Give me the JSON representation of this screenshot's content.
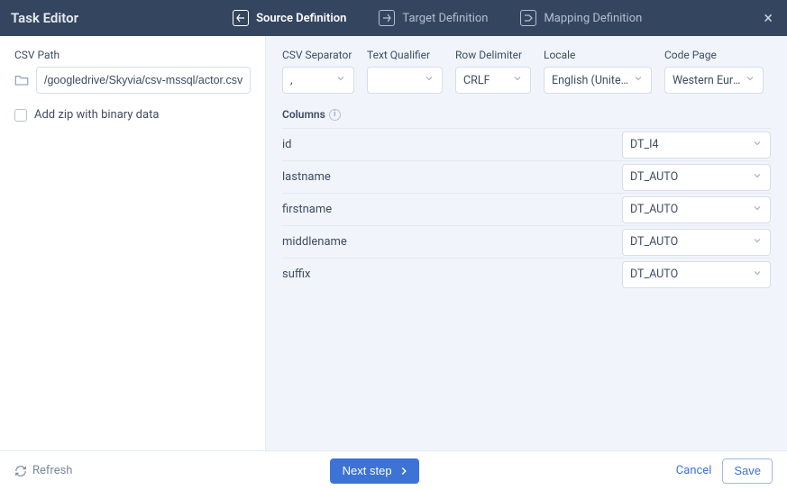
{
  "header": {
    "title": "Task Editor",
    "tabs": [
      {
        "label": "Source Definition",
        "active": true
      },
      {
        "label": "Target Definition",
        "active": false
      },
      {
        "label": "Mapping Definition",
        "active": false
      }
    ]
  },
  "sidebar": {
    "csv_path_label": "CSV Path",
    "csv_path_value": "/googledrive/Skyvia/csv-mssql/actor.csv",
    "addzip_label": "Add zip with binary data",
    "addzip_checked": false
  },
  "params": {
    "csv_separator": {
      "label": "CSV Separator",
      "value": ","
    },
    "text_qualifier": {
      "label": "Text Qualifier",
      "value": ""
    },
    "row_delimiter": {
      "label": "Row Delimiter",
      "value": "CRLF"
    },
    "locale": {
      "label": "Locale",
      "value": "English (United St…"
    },
    "code_page": {
      "label": "Code Page",
      "value": "Western Europea…"
    }
  },
  "columns_label": "Columns",
  "columns": [
    {
      "name": "id",
      "type": "DT_I4"
    },
    {
      "name": "lastname",
      "type": "DT_AUTO"
    },
    {
      "name": "firstname",
      "type": "DT_AUTO"
    },
    {
      "name": "middlename",
      "type": "DT_AUTO"
    },
    {
      "name": "suffix",
      "type": "DT_AUTO"
    }
  ],
  "footer": {
    "refresh": "Refresh",
    "next": "Next step",
    "cancel": "Cancel",
    "save": "Save"
  }
}
